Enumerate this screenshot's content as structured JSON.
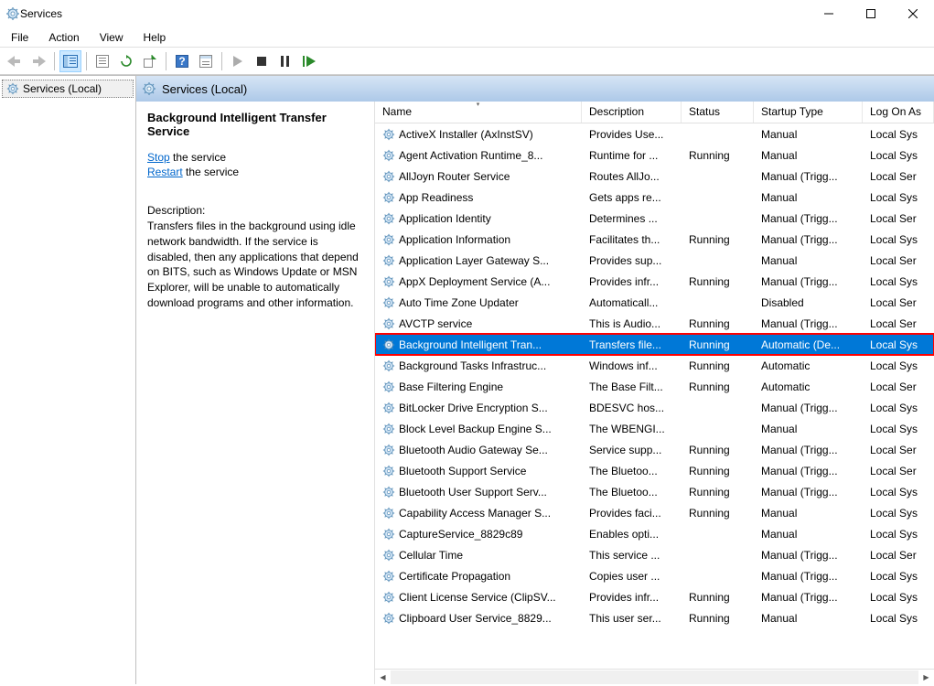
{
  "window": {
    "title": "Services"
  },
  "menu": {
    "file": "File",
    "action": "Action",
    "view": "View",
    "help": "Help"
  },
  "tree": {
    "root": "Services (Local)"
  },
  "content_header": "Services (Local)",
  "detail": {
    "title": "Background Intelligent Transfer Service",
    "stop_link": "Stop",
    "stop_suffix": " the service",
    "restart_link": "Restart",
    "restart_suffix": " the service",
    "desc_label": "Description:",
    "desc": "Transfers files in the background using idle network bandwidth. If the service is disabled, then any applications that depend on BITS, such as Windows Update or MSN Explorer, will be unable to automatically download programs and other information."
  },
  "columns": {
    "name": "Name",
    "desc": "Description",
    "status": "Status",
    "startup": "Startup Type",
    "logon": "Log On As"
  },
  "rows": [
    {
      "name": "ActiveX Installer (AxInstSV)",
      "desc": "Provides Use...",
      "status": "",
      "startup": "Manual",
      "logon": "Local Sys"
    },
    {
      "name": "Agent Activation Runtime_8...",
      "desc": "Runtime for ...",
      "status": "Running",
      "startup": "Manual",
      "logon": "Local Sys"
    },
    {
      "name": "AllJoyn Router Service",
      "desc": "Routes AllJo...",
      "status": "",
      "startup": "Manual (Trigg...",
      "logon": "Local Ser"
    },
    {
      "name": "App Readiness",
      "desc": "Gets apps re...",
      "status": "",
      "startup": "Manual",
      "logon": "Local Sys"
    },
    {
      "name": "Application Identity",
      "desc": "Determines ...",
      "status": "",
      "startup": "Manual (Trigg...",
      "logon": "Local Ser"
    },
    {
      "name": "Application Information",
      "desc": "Facilitates th...",
      "status": "Running",
      "startup": "Manual (Trigg...",
      "logon": "Local Sys"
    },
    {
      "name": "Application Layer Gateway S...",
      "desc": "Provides sup...",
      "status": "",
      "startup": "Manual",
      "logon": "Local Ser"
    },
    {
      "name": "AppX Deployment Service (A...",
      "desc": "Provides infr...",
      "status": "Running",
      "startup": "Manual (Trigg...",
      "logon": "Local Sys"
    },
    {
      "name": "Auto Time Zone Updater",
      "desc": "Automaticall...",
      "status": "",
      "startup": "Disabled",
      "logon": "Local Ser"
    },
    {
      "name": "AVCTP service",
      "desc": "This is Audio...",
      "status": "Running",
      "startup": "Manual (Trigg...",
      "logon": "Local Ser"
    },
    {
      "name": "Background Intelligent Tran...",
      "desc": "Transfers file...",
      "status": "Running",
      "startup": "Automatic (De...",
      "logon": "Local Sys",
      "selected": true,
      "highlighted": true
    },
    {
      "name": "Background Tasks Infrastruc...",
      "desc": "Windows inf...",
      "status": "Running",
      "startup": "Automatic",
      "logon": "Local Sys"
    },
    {
      "name": "Base Filtering Engine",
      "desc": "The Base Filt...",
      "status": "Running",
      "startup": "Automatic",
      "logon": "Local Ser"
    },
    {
      "name": "BitLocker Drive Encryption S...",
      "desc": "BDESVC hos...",
      "status": "",
      "startup": "Manual (Trigg...",
      "logon": "Local Sys"
    },
    {
      "name": "Block Level Backup Engine S...",
      "desc": "The WBENGI...",
      "status": "",
      "startup": "Manual",
      "logon": "Local Sys"
    },
    {
      "name": "Bluetooth Audio Gateway Se...",
      "desc": "Service supp...",
      "status": "Running",
      "startup": "Manual (Trigg...",
      "logon": "Local Ser"
    },
    {
      "name": "Bluetooth Support Service",
      "desc": "The Bluetoo...",
      "status": "Running",
      "startup": "Manual (Trigg...",
      "logon": "Local Ser"
    },
    {
      "name": "Bluetooth User Support Serv...",
      "desc": "The Bluetoo...",
      "status": "Running",
      "startup": "Manual (Trigg...",
      "logon": "Local Sys"
    },
    {
      "name": "Capability Access Manager S...",
      "desc": "Provides faci...",
      "status": "Running",
      "startup": "Manual",
      "logon": "Local Sys"
    },
    {
      "name": "CaptureService_8829c89",
      "desc": "Enables opti...",
      "status": "",
      "startup": "Manual",
      "logon": "Local Sys"
    },
    {
      "name": "Cellular Time",
      "desc": "This service ...",
      "status": "",
      "startup": "Manual (Trigg...",
      "logon": "Local Ser"
    },
    {
      "name": "Certificate Propagation",
      "desc": "Copies user ...",
      "status": "",
      "startup": "Manual (Trigg...",
      "logon": "Local Sys"
    },
    {
      "name": "Client License Service (ClipSV...",
      "desc": "Provides infr...",
      "status": "Running",
      "startup": "Manual (Trigg...",
      "logon": "Local Sys"
    },
    {
      "name": "Clipboard User Service_8829...",
      "desc": "This user ser...",
      "status": "Running",
      "startup": "Manual",
      "logon": "Local Sys"
    }
  ]
}
